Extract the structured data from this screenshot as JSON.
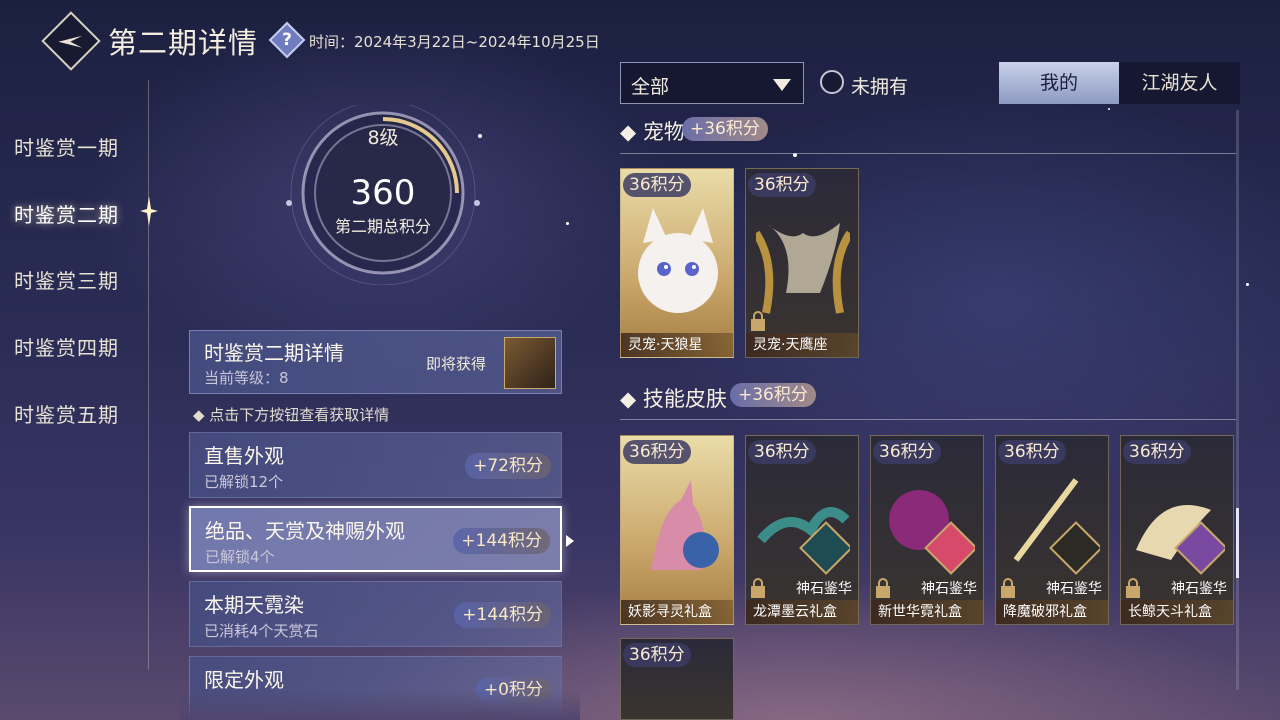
{
  "header": {
    "title": "第二期详情",
    "help_icon": "question-mark-icon",
    "time": "时间：2024年3月22日~2024年10月25日"
  },
  "nav": {
    "items": [
      {
        "label": "时鉴赏一期"
      },
      {
        "label": "时鉴赏二期",
        "active": true
      },
      {
        "label": "时鉴赏三期"
      },
      {
        "label": "时鉴赏四期"
      },
      {
        "label": "时鉴赏五期"
      }
    ]
  },
  "progress": {
    "level": "8级",
    "points": "360",
    "label": "第二期总积分",
    "ring_fill_fraction": 0.25
  },
  "detail": {
    "title": "时鉴赏二期详情",
    "current_level": "当前等级：8",
    "coming_soon": "即将获得"
  },
  "hint": "◆ 点击下方按钮查看获取详情",
  "categories": [
    {
      "title": "直售外观",
      "sub": "已解锁12个",
      "points": "+72积分"
    },
    {
      "title": "绝品、天赏及神赐外观",
      "sub": "已解锁4个",
      "points": "+144积分",
      "selected": true
    },
    {
      "title": "本期天霓染",
      "sub": "已消耗4个天赏石",
      "points": "+144积分"
    },
    {
      "title": "限定外观",
      "sub": "",
      "points": "+0积分"
    }
  ],
  "filter": {
    "selected": "全部",
    "not_owned_label": "未拥有"
  },
  "tabs": {
    "mine": "我的",
    "friends": "江湖友人"
  },
  "sections": {
    "pets": {
      "title": "宠物",
      "points": "+36积分",
      "cards": [
        {
          "points": "36积分",
          "name": "灵宠·天狼星",
          "owned": true
        },
        {
          "points": "36积分",
          "name": "灵宠·天鹰座",
          "owned": false
        }
      ]
    },
    "skins": {
      "title": "技能皮肤",
      "points": "+36积分",
      "cards": [
        {
          "points": "36积分",
          "name": "妖影寻灵礼盒",
          "badge": "",
          "owned": true
        },
        {
          "points": "36积分",
          "name": "龙潭墨云礼盒",
          "badge": "神石鉴华",
          "owned": false
        },
        {
          "points": "36积分",
          "name": "新世华霓礼盒",
          "badge": "神石鉴华",
          "owned": false
        },
        {
          "points": "36积分",
          "name": "降魔破邪礼盒",
          "badge": "神石鉴华",
          "owned": false
        },
        {
          "points": "36积分",
          "name": "长鲸天斗礼盒",
          "badge": "神石鉴华",
          "owned": false
        },
        {
          "points": "36积分",
          "name": "",
          "badge": "",
          "owned": false
        }
      ]
    }
  },
  "colors": {
    "accent_gold": "#c9a66a",
    "tab_active": "#c7d1e8",
    "points_text": "#fbead0"
  }
}
